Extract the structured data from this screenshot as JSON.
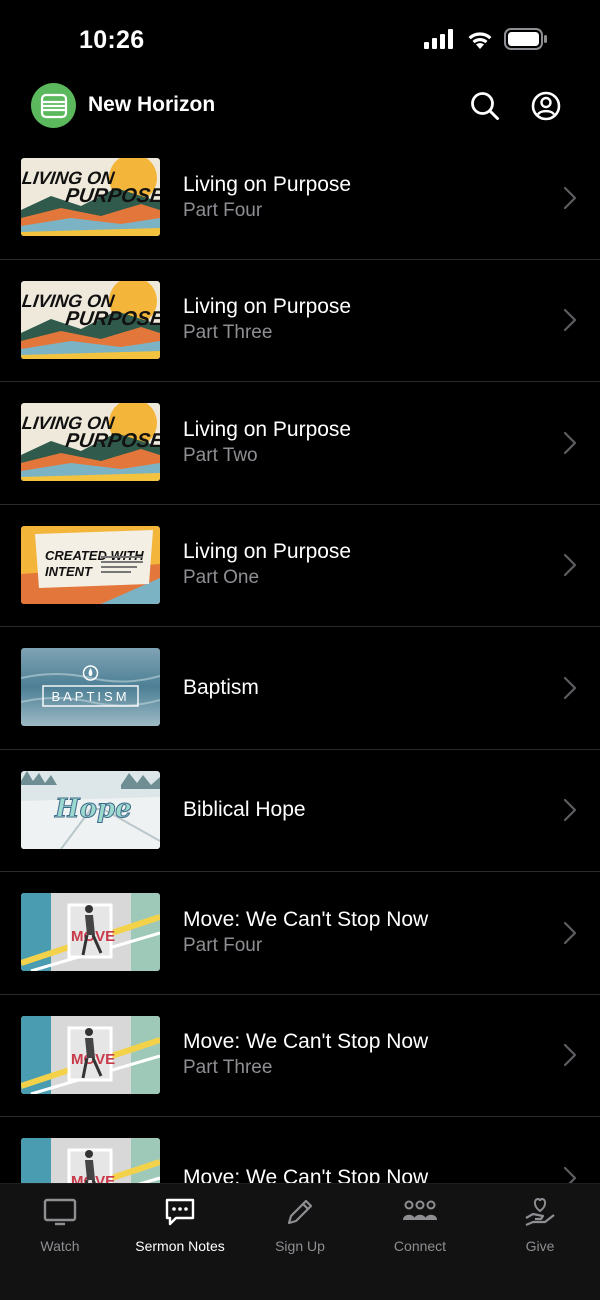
{
  "status_bar": {
    "time": "10:26"
  },
  "header": {
    "title": "New Horizon",
    "logo_icon": "bible-icon",
    "search_icon": "search-icon",
    "profile_icon": "profile-icon",
    "accent_color": "#5cb85c"
  },
  "sermons": [
    {
      "title": "Living on Purpose",
      "subtitle": "Part Four",
      "thumb_text": [
        "LIVING ON",
        "PURPOSE"
      ],
      "thumb": "living"
    },
    {
      "title": "Living on Purpose",
      "subtitle": "Part Three",
      "thumb_text": [
        "LIVING ON",
        "PURPOSE"
      ],
      "thumb": "living"
    },
    {
      "title": "Living on Purpose",
      "subtitle": "Part Two",
      "thumb_text": [
        "LIVING ON",
        "PURPOSE"
      ],
      "thumb": "living"
    },
    {
      "title": "Living on Purpose",
      "subtitle": "Part One",
      "thumb_text": [
        "CREATED WITH",
        "INTENT"
      ],
      "thumb": "created"
    },
    {
      "title": "Baptism",
      "subtitle": "",
      "thumb_text": [
        "BAPTISM"
      ],
      "thumb": "baptism"
    },
    {
      "title": "Biblical Hope",
      "subtitle": "",
      "thumb_text": [
        "Hope"
      ],
      "thumb": "hope"
    },
    {
      "title": "Move: We Can't Stop Now",
      "subtitle": "Part Four",
      "thumb_text": [
        "MOVE"
      ],
      "thumb": "move"
    },
    {
      "title": "Move: We Can't Stop Now",
      "subtitle": "Part Three",
      "thumb_text": [
        "MOVE"
      ],
      "thumb": "move"
    },
    {
      "title": "Move: We Can't Stop Now",
      "subtitle": "",
      "thumb_text": [
        "MOVE"
      ],
      "thumb": "move"
    }
  ],
  "tabs": [
    {
      "label": "Watch",
      "icon": "tv-icon",
      "active": false
    },
    {
      "label": "Sermon Notes",
      "icon": "chat-icon",
      "active": true
    },
    {
      "label": "Sign Up",
      "icon": "pencil-icon",
      "active": false
    },
    {
      "label": "Connect",
      "icon": "group-icon",
      "active": false
    },
    {
      "label": "Give",
      "icon": "heart-hand-icon",
      "active": false
    }
  ]
}
